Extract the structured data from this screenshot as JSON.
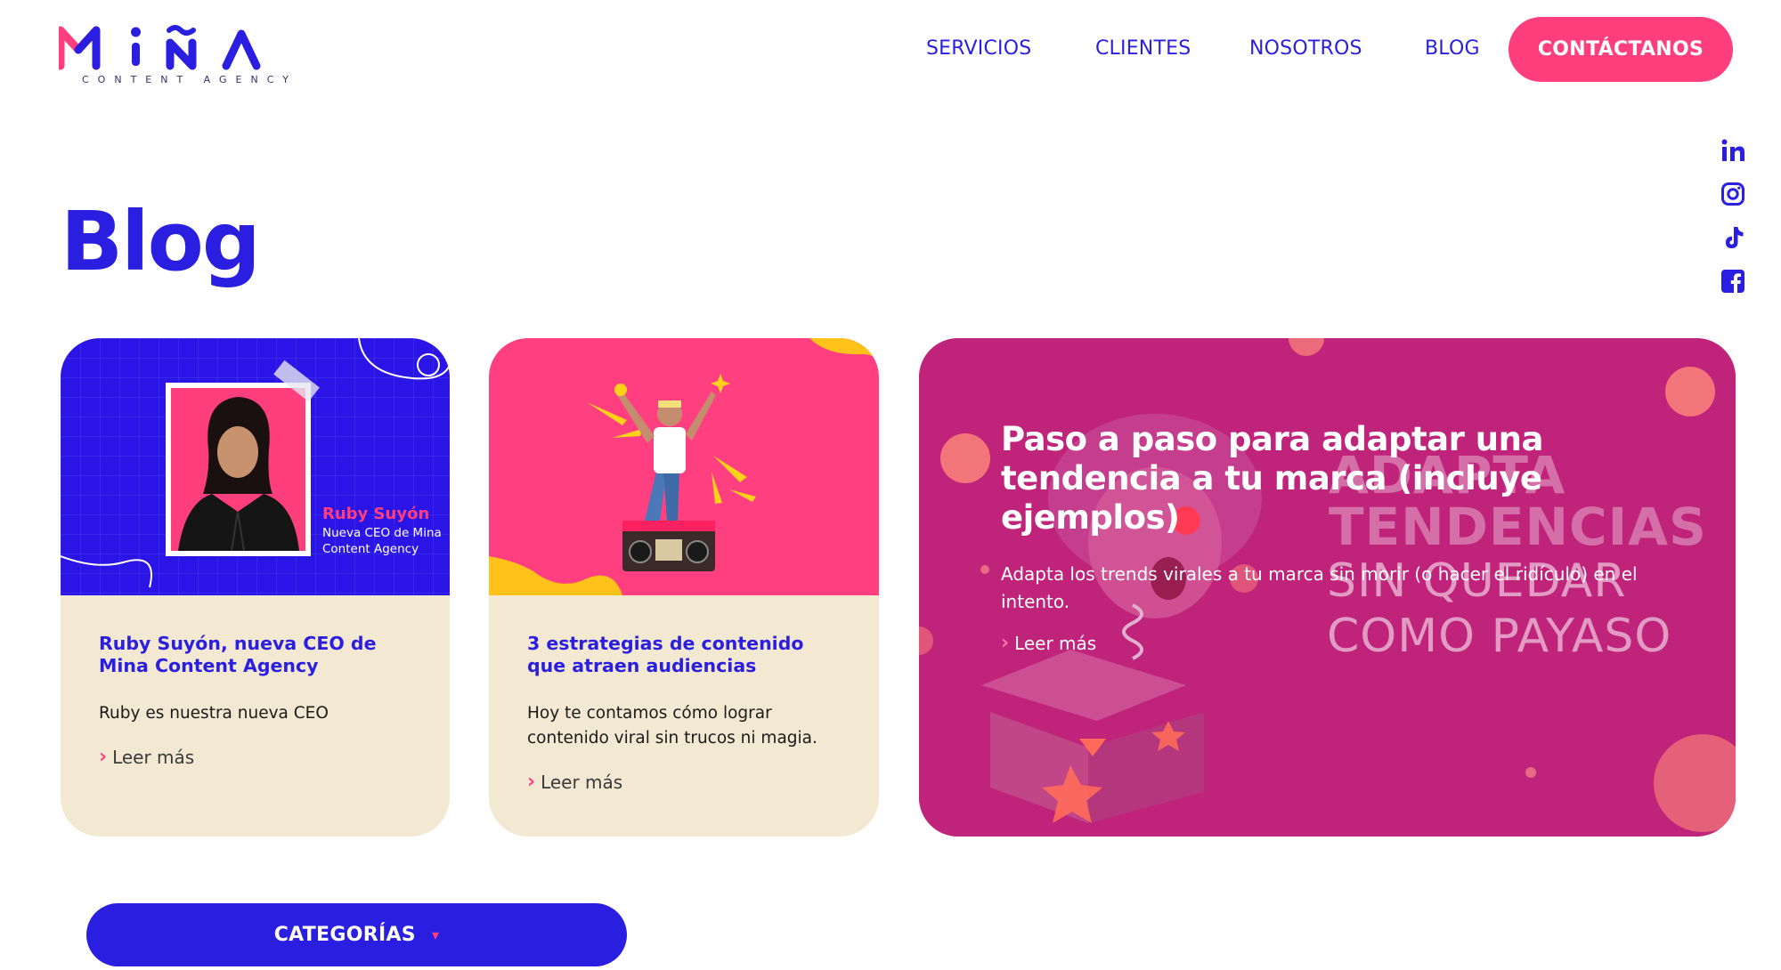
{
  "brand": {
    "name": "MiNA",
    "tagline": "CONTENT AGENCY",
    "colors": {
      "primary": "#2a1fe0",
      "accent": "#ff3e7e",
      "cream": "#f3e9d3",
      "magenta": "#c6267e"
    }
  },
  "nav": {
    "items": [
      "SERVICIOS",
      "CLIENTES",
      "NOSOTROS",
      "BLOG"
    ],
    "cta": "CONTÁCTANOS"
  },
  "social": {
    "icons": [
      "linkedin-icon",
      "instagram-icon",
      "tiktok-icon",
      "facebook-icon"
    ]
  },
  "page": {
    "title": "Blog"
  },
  "cards": [
    {
      "image_name": "Ruby Suyón",
      "image_role": "Nueva CEO de Mina Content Agency",
      "title": "Ruby Suyón, nueva CEO de Mina Content Agency",
      "description": "Ruby es nuestra nueva CEO",
      "read_more": "Leer más"
    },
    {
      "title": "3 estrategias de contenido que atraen audiencias",
      "description": "Hoy te contamos cómo lograr contenido viral sin trucos ni magia.",
      "read_more": "Leer más"
    }
  ],
  "featured": {
    "title": "Paso a paso para adaptar una tendencia a tu marca (incluye ejemplos)",
    "description": "Adapta los trends virales a tu marca sin morir (o hacer el ridículo) en el intento.",
    "read_more": "Leer más",
    "image_headline_1": "ADAPTA",
    "image_headline_2": "TENDENCIAS",
    "image_sub_1": "SIN QUEDAR",
    "image_sub_2": "COMO PAYASO"
  },
  "categories": {
    "label": "CATEGORÍAS"
  }
}
